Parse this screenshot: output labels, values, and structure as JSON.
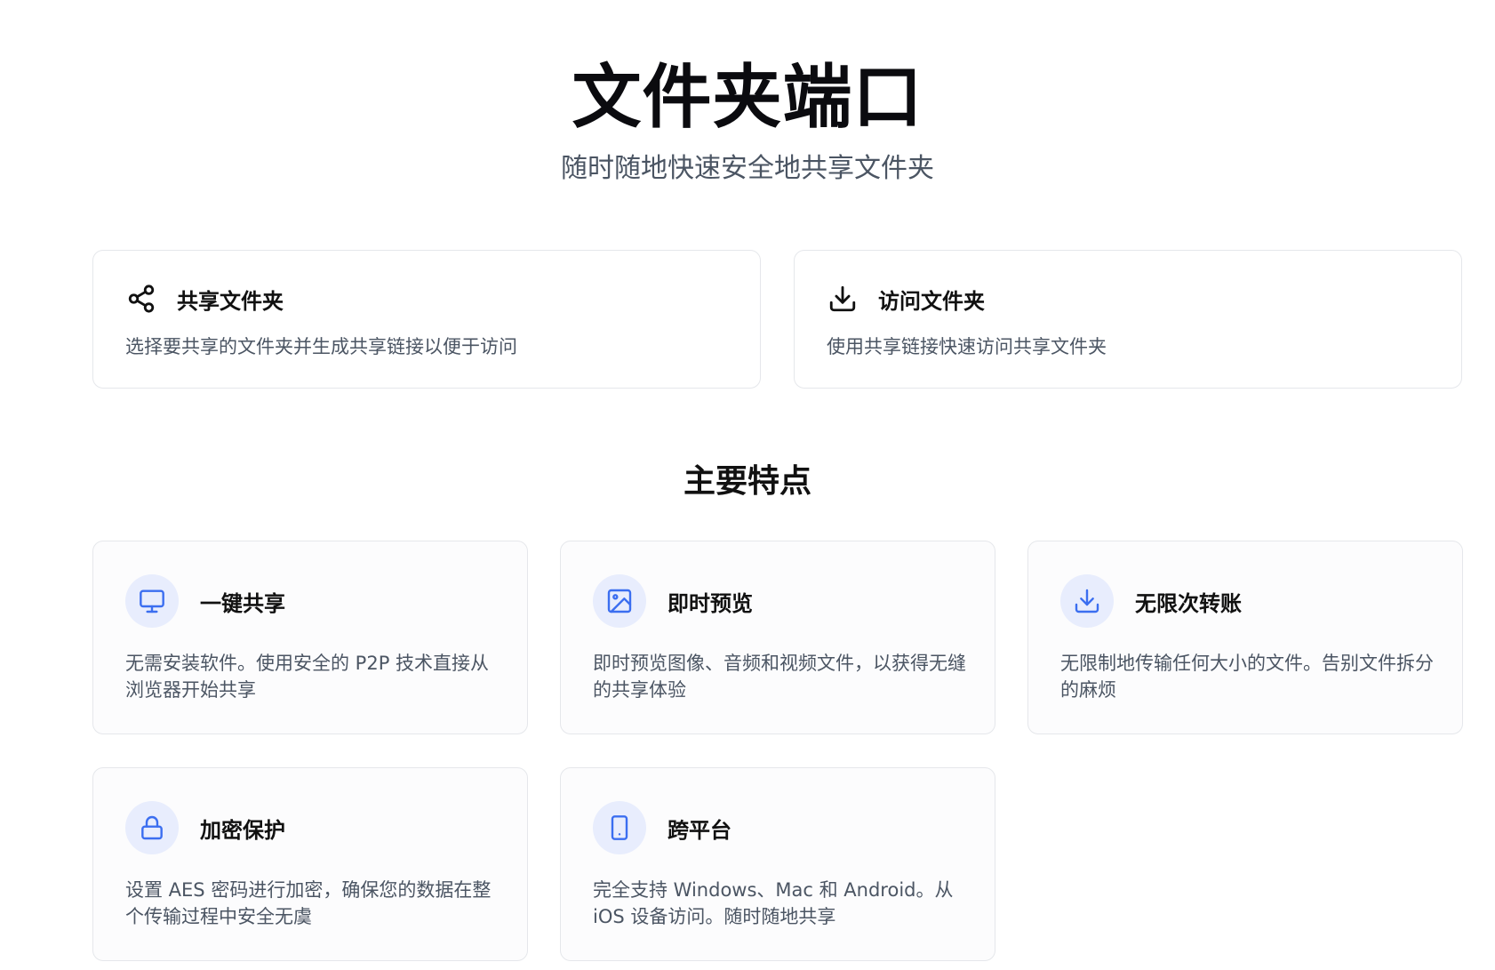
{
  "hero": {
    "title": "文件夹端口",
    "subtitle": "随时随地快速安全地共享文件夹"
  },
  "actions": [
    {
      "icon": "share-icon",
      "title": "共享文件夹",
      "desc": "选择要共享的文件夹并生成共享链接以便于访问"
    },
    {
      "icon": "download-icon",
      "title": "访问文件夹",
      "desc": "使用共享链接快速访问共享文件夹"
    }
  ],
  "features_section": {
    "title": "主要特点",
    "accent_color": "#3b6ef0",
    "icon_bg": "#e8edfd",
    "items": [
      {
        "icon": "monitor-icon",
        "title": "一键共享",
        "desc": "无需安装软件。使用安全的 P2P 技术直接从浏览器开始共享"
      },
      {
        "icon": "image-icon",
        "title": "即时预览",
        "desc": "即时预览图像、音频和视频文件，以获得无缝的共享体验"
      },
      {
        "icon": "download-icon",
        "title": "无限次转账",
        "desc": "无限制地传输任何大小的文件。告别文件拆分的麻烦"
      },
      {
        "icon": "lock-icon",
        "title": "加密保护",
        "desc": "设置 AES 密码进行加密，确保您的数据在整个传输过程中安全无虞"
      },
      {
        "icon": "tablet-icon",
        "title": "跨平台",
        "desc": "完全支持 Windows、Mac 和 Android。从 iOS 设备访问。随时随地共享"
      }
    ]
  }
}
